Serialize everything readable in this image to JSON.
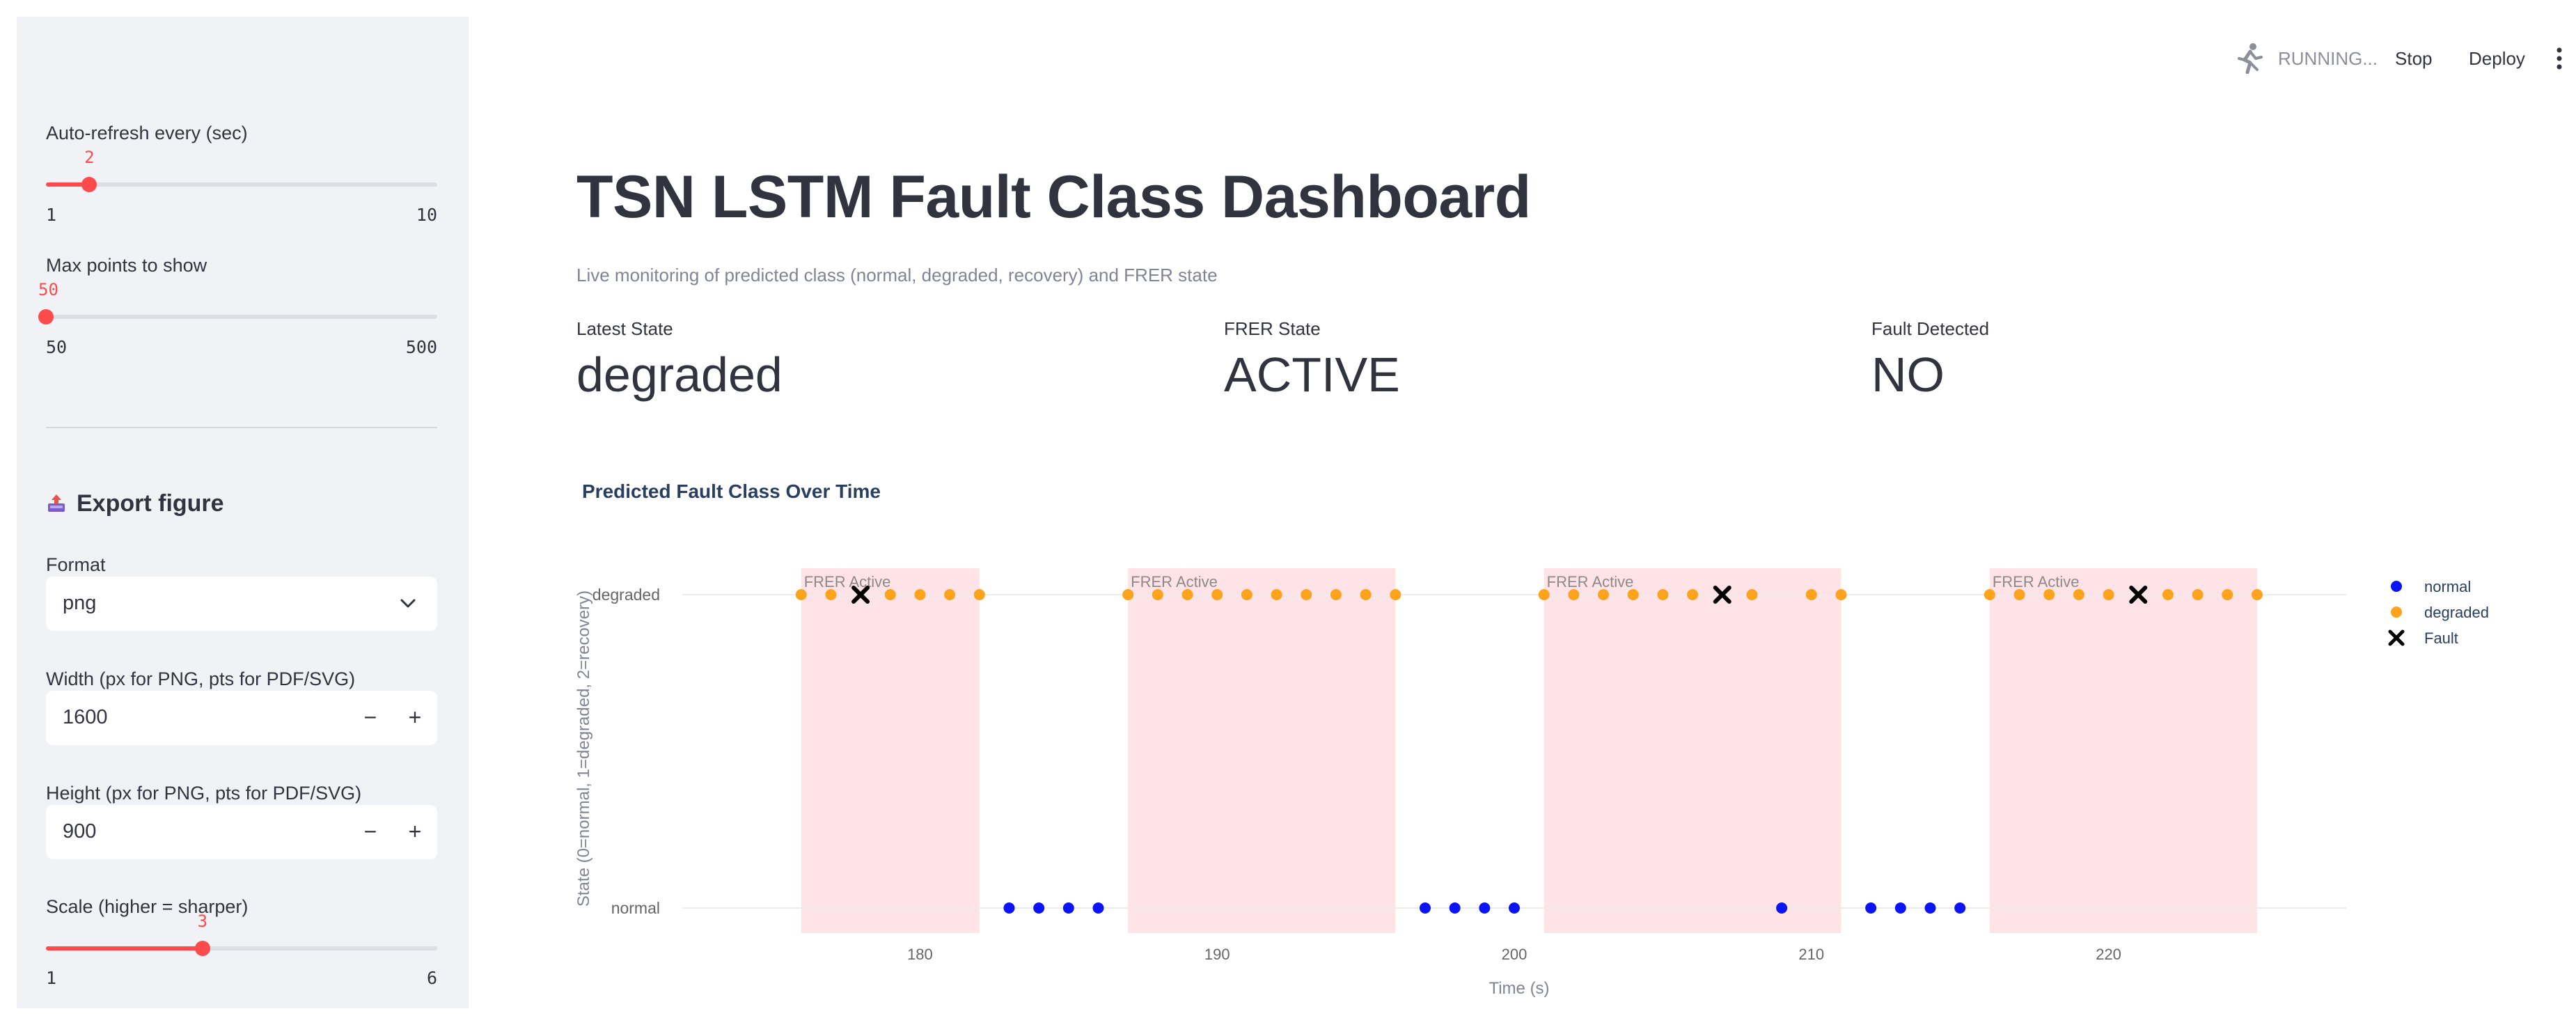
{
  "sidebar": {
    "refresh": {
      "label": "Auto-refresh every (sec)",
      "value": "2",
      "min": "1",
      "max": "10",
      "fraction": 0.111
    },
    "max_points": {
      "label": "Max points to show",
      "value": "50",
      "min": "50",
      "max": "500",
      "fraction": 0.0
    },
    "export": {
      "header": "Export figure",
      "format_label": "Format",
      "format_value": "png",
      "width_label": "Width (px for PNG, pts for PDF/SVG)",
      "width_value": "1600",
      "height_label": "Height (px for PNG, pts for PDF/SVG)",
      "height_value": "900",
      "minus": "−",
      "plus": "+",
      "scale": {
        "label": "Scale (higher = sharper)",
        "value": "3",
        "min": "1",
        "max": "6",
        "fraction": 0.4
      }
    }
  },
  "toolbar": {
    "status": "RUNNING...",
    "stop": "Stop",
    "deploy": "Deploy"
  },
  "main": {
    "title": "TSN LSTM Fault Class Dashboard",
    "subtitle": "Live monitoring of predicted class (normal, degraded, recovery) and FRER state",
    "metrics": [
      {
        "label": "Latest State",
        "value": "degraded"
      },
      {
        "label": "FRER State",
        "value": "ACTIVE"
      },
      {
        "label": "Fault Detected",
        "value": "NO"
      }
    ]
  },
  "colors": {
    "accent": "#ff4b4b",
    "normal": "#0a14f5",
    "degraded": "#ffa21c",
    "fault": "#000000",
    "frer_band": "#ffe3e6"
  },
  "chart_data": {
    "type": "scatter",
    "title": "Predicted Fault Class Over Time",
    "xlabel": "Time (s)",
    "ylabel": "State (0=normal, 1=degraded, 2=recovery)",
    "xlim": [
      172,
      228
    ],
    "x_ticks": [
      180,
      190,
      200,
      210,
      220
    ],
    "y_ticks": [
      {
        "value": 0,
        "label": "normal"
      },
      {
        "value": 1,
        "label": "degraded"
      }
    ],
    "grid": true,
    "legend_position": "right",
    "series": [
      {
        "name": "normal",
        "marker": "circle",
        "color": "#0a14f5",
        "points": [
          [
            183,
            0
          ],
          [
            184,
            0
          ],
          [
            185,
            0
          ],
          [
            186,
            0
          ],
          [
            197,
            0
          ],
          [
            198,
            0
          ],
          [
            199,
            0
          ],
          [
            200,
            0
          ],
          [
            209,
            0
          ],
          [
            212,
            0
          ],
          [
            213,
            0
          ],
          [
            214,
            0
          ],
          [
            215,
            0
          ]
        ]
      },
      {
        "name": "degraded",
        "marker": "circle",
        "color": "#ffa21c",
        "points": [
          [
            176,
            1
          ],
          [
            177,
            1
          ],
          [
            179,
            1
          ],
          [
            180,
            1
          ],
          [
            181,
            1
          ],
          [
            182,
            1
          ],
          [
            187,
            1
          ],
          [
            188,
            1
          ],
          [
            189,
            1
          ],
          [
            190,
            1
          ],
          [
            191,
            1
          ],
          [
            192,
            1
          ],
          [
            193,
            1
          ],
          [
            194,
            1
          ],
          [
            195,
            1
          ],
          [
            196,
            1
          ],
          [
            201,
            1
          ],
          [
            202,
            1
          ],
          [
            203,
            1
          ],
          [
            204,
            1
          ],
          [
            205,
            1
          ],
          [
            206,
            1
          ],
          [
            208,
            1
          ],
          [
            210,
            1
          ],
          [
            211,
            1
          ],
          [
            216,
            1
          ],
          [
            217,
            1
          ],
          [
            218,
            1
          ],
          [
            219,
            1
          ],
          [
            220,
            1
          ],
          [
            222,
            1
          ],
          [
            223,
            1
          ],
          [
            224,
            1
          ],
          [
            225,
            1
          ]
        ]
      },
      {
        "name": "Fault",
        "marker": "x",
        "color": "#000000",
        "points": [
          [
            178,
            1
          ],
          [
            207,
            1
          ],
          [
            221,
            1
          ]
        ]
      }
    ],
    "frer_regions": [
      {
        "label": "FRER Active",
        "start": 176,
        "end": 182
      },
      {
        "label": "FRER Active",
        "start": 187,
        "end": 196
      },
      {
        "label": "FRER Active",
        "start": 201,
        "end": 211
      },
      {
        "label": "FRER Active",
        "start": 216,
        "end": 225
      }
    ]
  }
}
